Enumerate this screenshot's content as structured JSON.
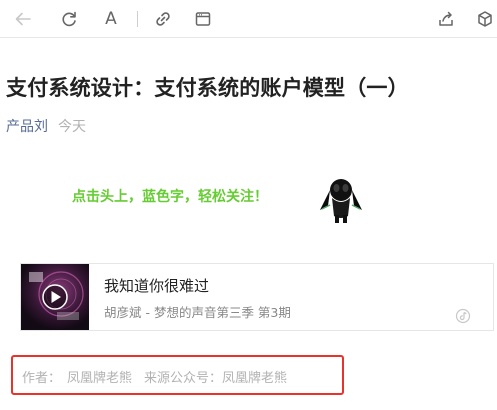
{
  "toolbar": {
    "icons": [
      "back-arrow-icon",
      "refresh-icon",
      "font-size-icon",
      "link-icon",
      "browser-window-icon",
      "share-icon",
      "cube-icon"
    ],
    "font_label": "A"
  },
  "article": {
    "title": "支付系统设计：支付系统的账户模型（一）",
    "author": "产品刘",
    "date": "今天",
    "follow_prompt": "点击头上，蓝色字，轻松关注！"
  },
  "music": {
    "song_title": "我知道你很难过",
    "singer_line": "胡彦斌 - 梦想的声音第三季 第3期"
  },
  "source": {
    "author_label": "作者：",
    "author_value": "凤凰牌老熊",
    "account_label": "来源公众号：",
    "account_value": "凤凰牌老熊"
  },
  "colors": {
    "author_link": "#576b95",
    "follow_green": "#66cc33",
    "highlight_red": "#e8332c",
    "muted_gray": "#b2b2b2"
  }
}
